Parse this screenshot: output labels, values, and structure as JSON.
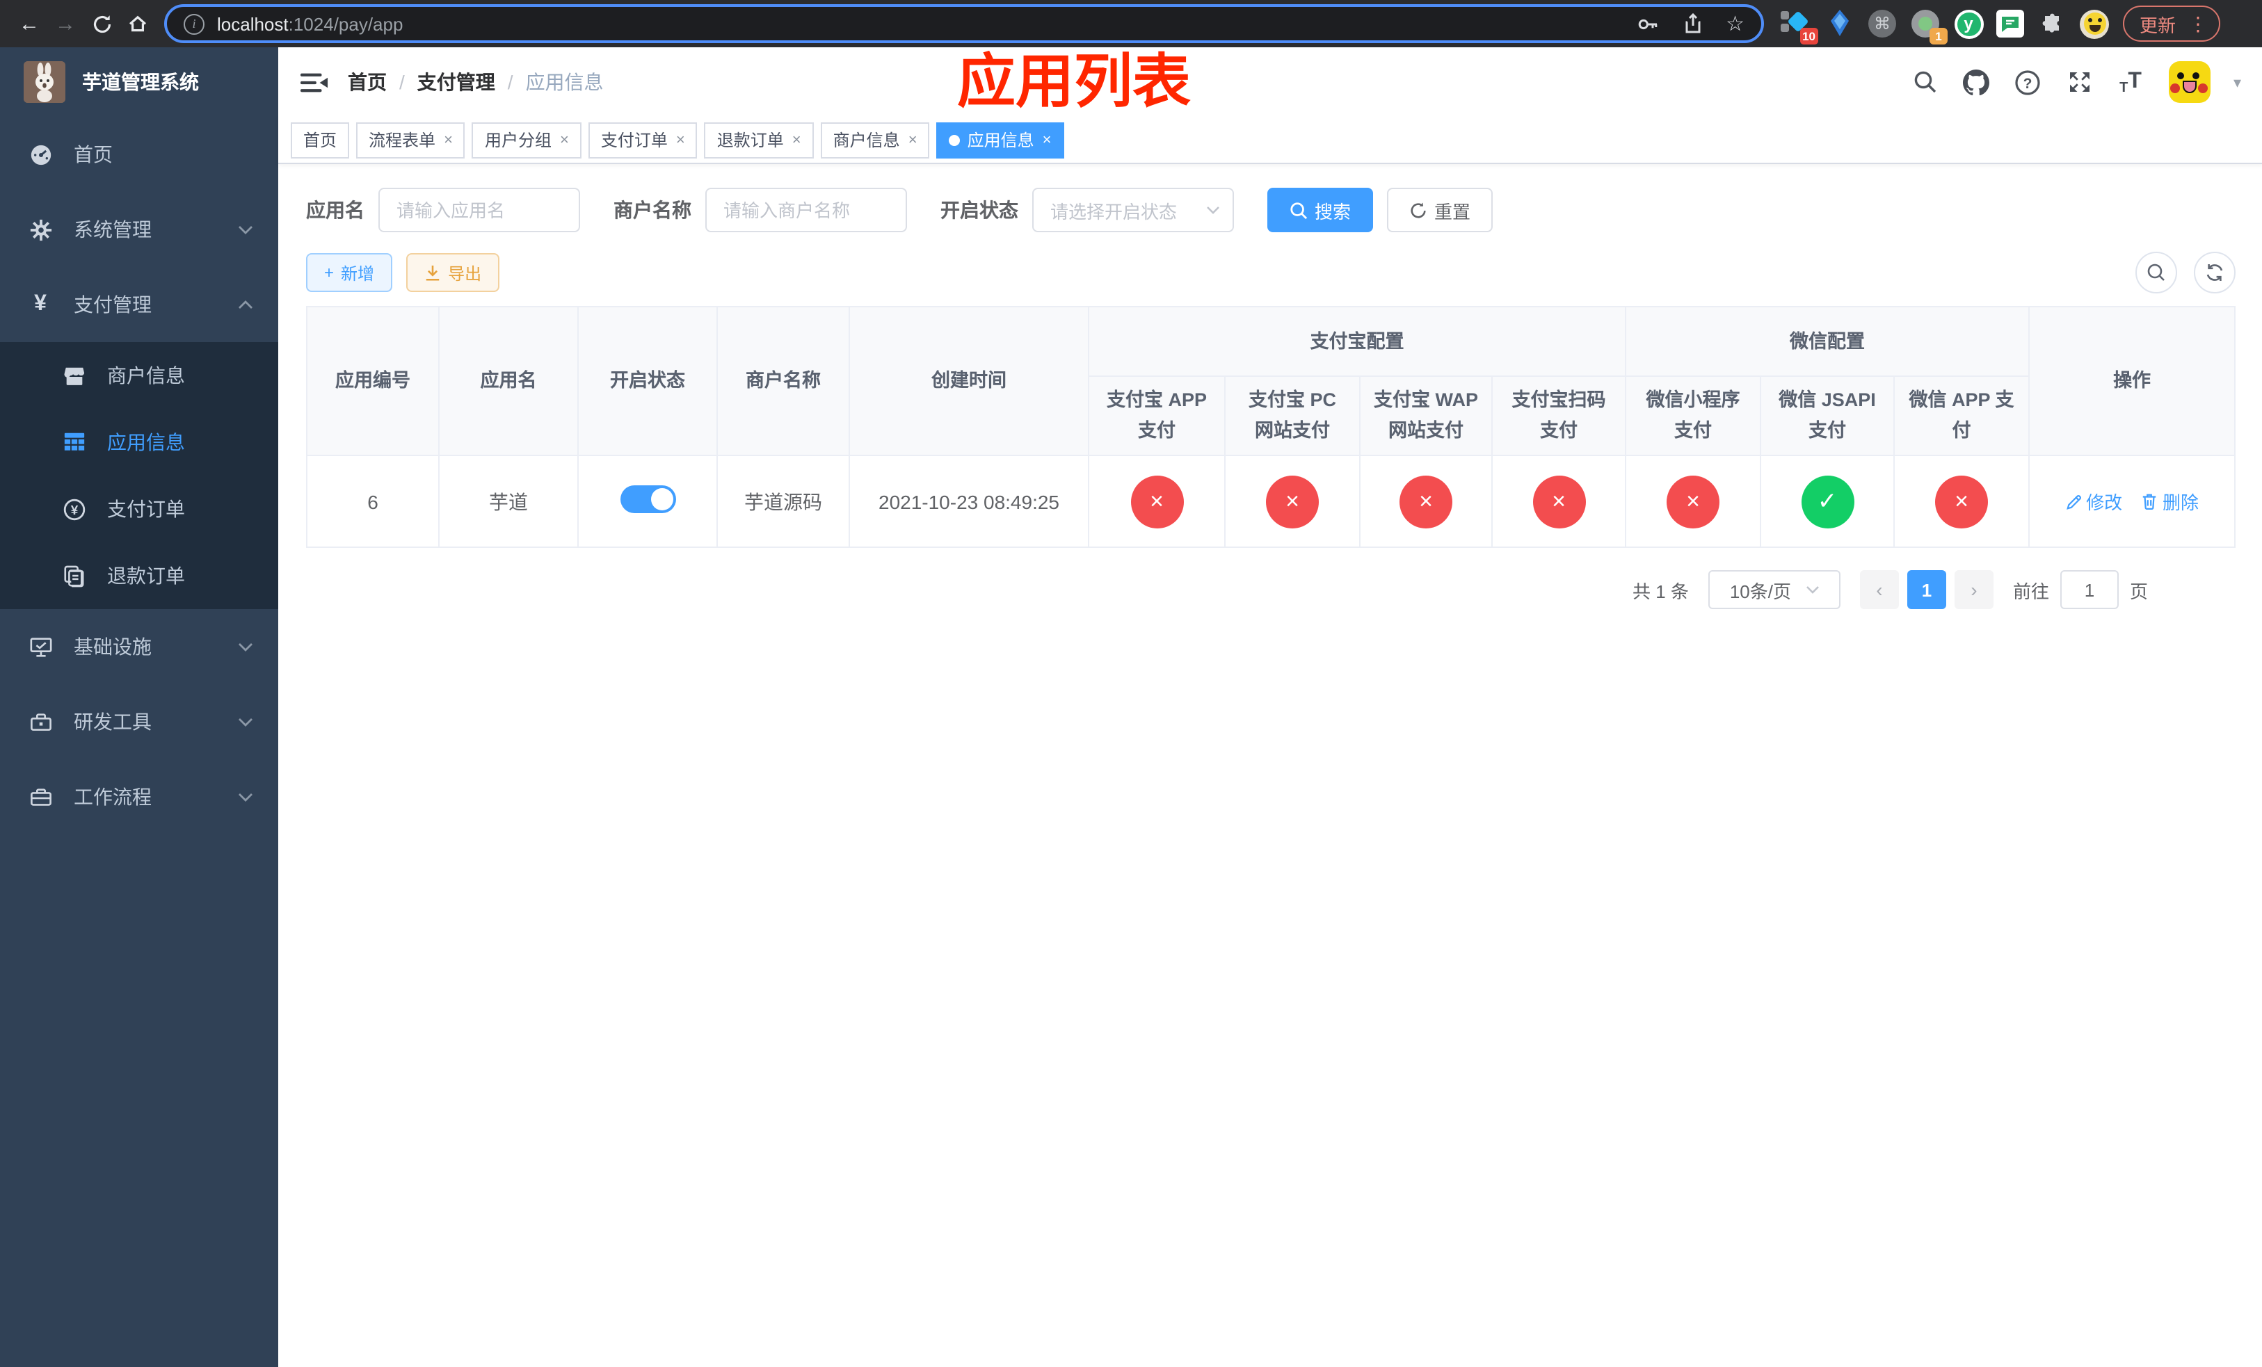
{
  "colors": {
    "accent": "#409eff",
    "danger": "#f34d4f",
    "success": "#13ce66",
    "warning": "#e6a23c",
    "annotation_red": "#ff2600",
    "sidebar_bg": "#304156",
    "submenu_bg": "#1f2d3d"
  },
  "icons": {
    "close": "×",
    "caret_down": "▾",
    "prev": "‹",
    "next": "›",
    "plus": "+",
    "kebab": "⋮",
    "command": "⌘",
    "star": "☆",
    "back_arrow": "←",
    "forward_arrow": "→",
    "check": "✓",
    "cross": "×",
    "yuan": "¥",
    "ext_y": "y"
  },
  "browser": {
    "url_host": "localhost",
    "url_rest": ":1024/pay/app",
    "update_label": "更新",
    "ext_badge_blue_diamond": "10",
    "ext_badge_circle": "1"
  },
  "sidebar": {
    "title": "芋道管理系统",
    "items": [
      {
        "label": "首页"
      },
      {
        "label": "系统管理"
      },
      {
        "label": "支付管理"
      },
      {
        "label": "商户信息"
      },
      {
        "label": "应用信息"
      },
      {
        "label": "支付订单"
      },
      {
        "label": "退款订单"
      },
      {
        "label": "基础设施"
      },
      {
        "label": "研发工具"
      },
      {
        "label": "工作流程"
      }
    ]
  },
  "header": {
    "breadcrumb": [
      "首页",
      "支付管理",
      "应用信息"
    ],
    "separator": "/",
    "overlay_title": "应用列表"
  },
  "tabs": [
    {
      "label": "首页"
    },
    {
      "label": "流程表单"
    },
    {
      "label": "用户分组"
    },
    {
      "label": "支付订单"
    },
    {
      "label": "退款订单"
    },
    {
      "label": "商户信息"
    },
    {
      "label": "应用信息"
    }
  ],
  "search": {
    "fields": [
      {
        "label": "应用名",
        "placeholder": "请输入应用名"
      },
      {
        "label": "商户名称",
        "placeholder": "请输入商户名称"
      },
      {
        "label": "开启状态",
        "placeholder": "请选择开启状态"
      }
    ],
    "search_label": "搜索",
    "reset_label": "重置"
  },
  "toolbar": {
    "add_label": "新增",
    "export_label": "导出"
  },
  "table": {
    "group_alipay": "支付宝配置",
    "group_wechat": "微信配置",
    "columns": [
      "应用编号",
      "应用名",
      "开启状态",
      "商户名称",
      "创建时间",
      "支付宝 APP 支付",
      "支付宝 PC 网站支付",
      "支付宝 WAP 网站支付",
      "支付宝扫码支付",
      "微信小程序支付",
      "微信 JSAPI 支付",
      "微信 APP 支付",
      "操作"
    ],
    "row": {
      "id": "6",
      "name": "芋道",
      "enabled": true,
      "merchant_name": "芋道源码",
      "created_at": "2021-10-23 08:49:25",
      "statuses": [
        false,
        false,
        false,
        false,
        false,
        true,
        false
      ],
      "edit_label": "修改",
      "delete_label": "删除"
    }
  },
  "pagination": {
    "total_label": "共 1 条",
    "page_size_label": "10条/页",
    "current_page": "1",
    "goto_label": "前往",
    "goto_value": "1",
    "page_unit_label": "页"
  }
}
